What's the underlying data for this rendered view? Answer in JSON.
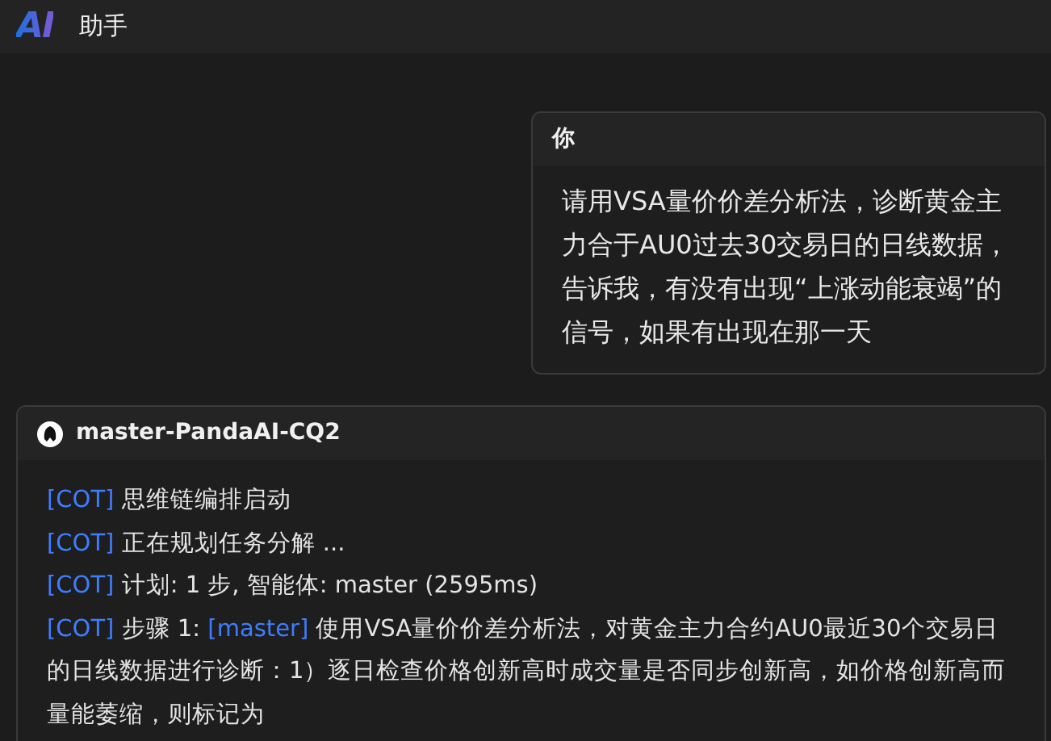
{
  "header": {
    "logo": "AI",
    "title": "助手"
  },
  "messages": [
    {
      "kind": "user",
      "author": "你",
      "text": "请用VSA量价价差分析法，诊断黄金主力合于AU0过去30交易日的日线数据，告诉我，有没有出现“上涨动能衰竭”的信号，如果有出现在那一天"
    },
    {
      "kind": "bot",
      "author": "master-PandaAI-CQ2",
      "lines": [
        [
          {
            "kind": "tag",
            "text": "[COT]"
          },
          {
            "kind": "plain",
            "text": " 思维链编排启动"
          }
        ],
        [
          {
            "kind": "tag",
            "text": "[COT]"
          },
          {
            "kind": "plain",
            "text": " 正在规划任务分解 ..."
          }
        ],
        [
          {
            "kind": "tag",
            "text": "[COT]"
          },
          {
            "kind": "plain",
            "text": " 计划: 1 步, 智能体: master (2595ms)"
          }
        ],
        [
          {
            "kind": "tag",
            "text": "[COT]"
          },
          {
            "kind": "plain",
            "text": " 步骤 1: "
          },
          {
            "kind": "tag",
            "text": "[master]"
          },
          {
            "kind": "plain",
            "text": " 使用VSA量价价差分析法，对黄金主力合约AU0最近30个交易日的日线数据进行诊断：1）逐日检查价格创新高时成交量是否同步创新高，如价格创新高而量能萎缩，则标记为"
          }
        ]
      ]
    }
  ]
}
